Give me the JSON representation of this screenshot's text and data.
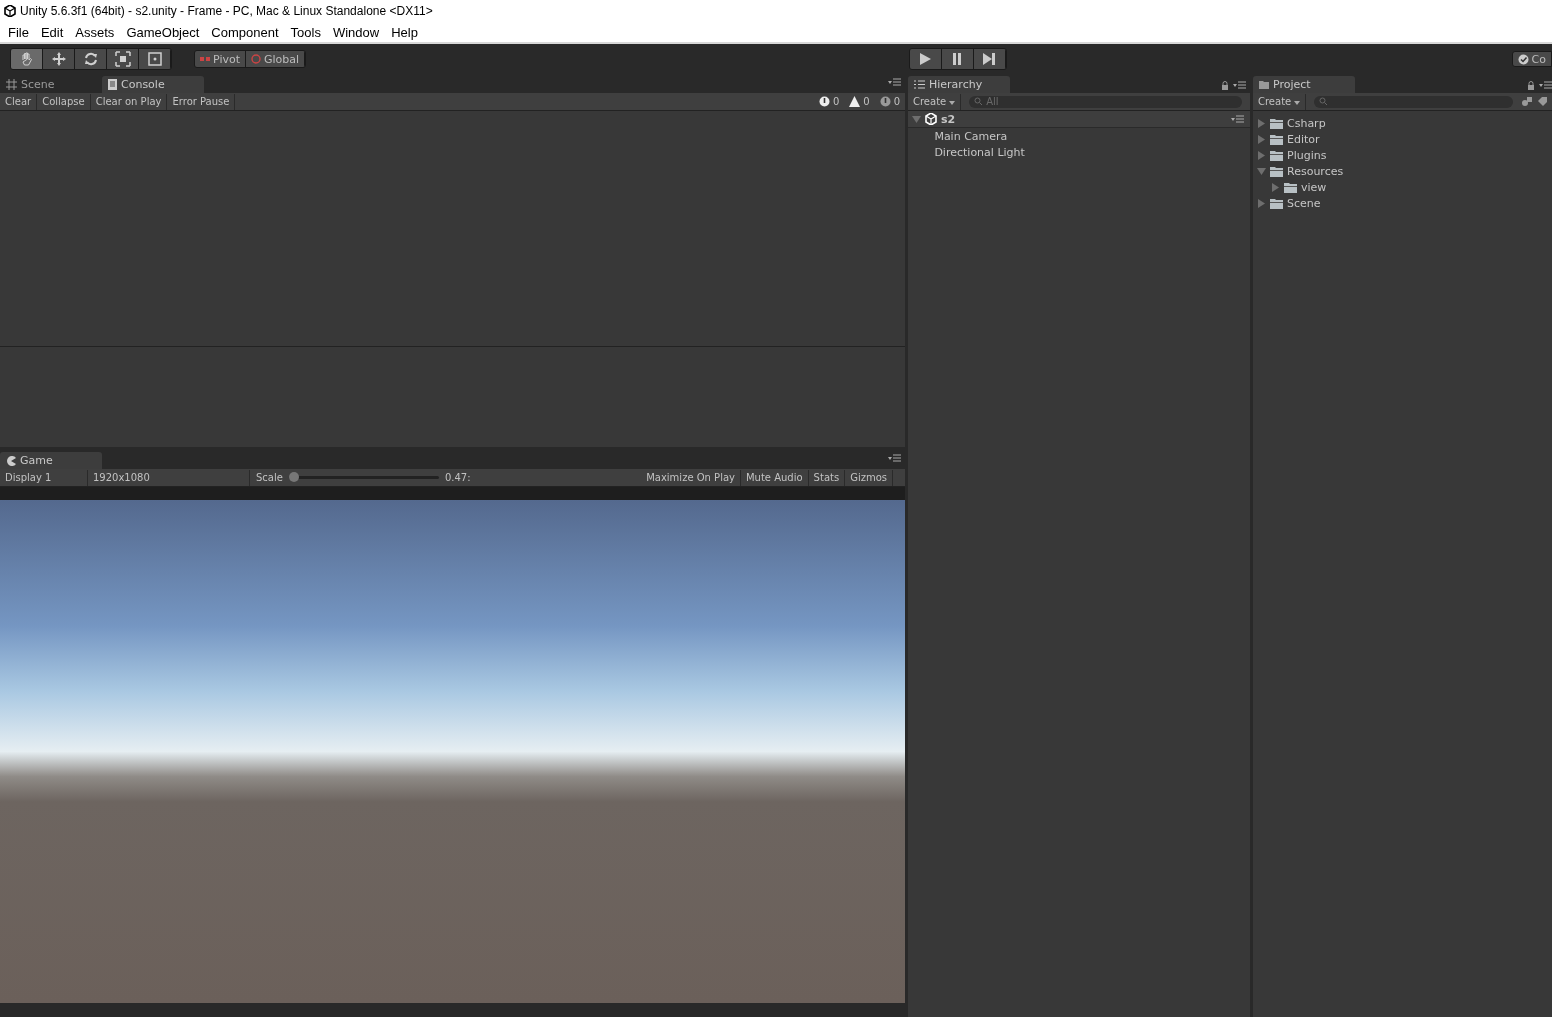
{
  "window": {
    "title": "Unity 5.6.3f1 (64bit) - s2.unity - Frame - PC, Mac & Linux Standalone <DX11>"
  },
  "menu": [
    "File",
    "Edit",
    "Assets",
    "GameObject",
    "Component",
    "Tools",
    "Window",
    "Help"
  ],
  "toolbar": {
    "tools": [
      {
        "kind": "hand",
        "selected": true
      },
      {
        "kind": "move",
        "selected": false
      },
      {
        "kind": "rotate",
        "selected": false
      },
      {
        "kind": "scale",
        "selected": false
      },
      {
        "kind": "rect",
        "selected": false
      }
    ],
    "pivot": "Pivot",
    "global": "Global",
    "collab": "Co"
  },
  "scene_tabs": [
    {
      "label": "Scene",
      "kind": "scene",
      "selected": false
    },
    {
      "label": "Console",
      "kind": "console",
      "selected": true
    }
  ],
  "console": {
    "buttons": [
      "Clear",
      "Collapse",
      "Clear on Play",
      "Error Pause"
    ],
    "counters": [
      {
        "kind": "info",
        "count": "0"
      },
      {
        "kind": "warning",
        "count": "0"
      },
      {
        "kind": "error",
        "count": "0"
      }
    ]
  },
  "game": {
    "tab": "Game",
    "display": "Display 1",
    "resolution": "1920x1080",
    "scale_label": "Scale",
    "scale": {
      "level": 0.0
    },
    "scale_value": "0.47:",
    "buttons": [
      "Maximize On Play",
      "Mute Audio",
      "Stats",
      "Gizmos"
    ]
  },
  "hierarchy": {
    "tab": "Hierarchy",
    "create": "Create",
    "search_placeholder": "All",
    "items": [
      {
        "label": "s2",
        "expanded": true,
        "children": [
          {
            "label": "Main Camera"
          },
          {
            "label": "Directional Light"
          }
        ]
      }
    ]
  },
  "project": {
    "tab": "Project",
    "create": "Create",
    "items": [
      {
        "label": "Csharp",
        "expanded": false
      },
      {
        "label": "Editor",
        "expanded": false
      },
      {
        "label": "Plugins",
        "expanded": false
      },
      {
        "label": "Resources",
        "expanded": true,
        "children": [
          {
            "label": "view",
            "expanded": false
          }
        ]
      },
      {
        "label": "Scene",
        "expanded": false
      }
    ]
  }
}
